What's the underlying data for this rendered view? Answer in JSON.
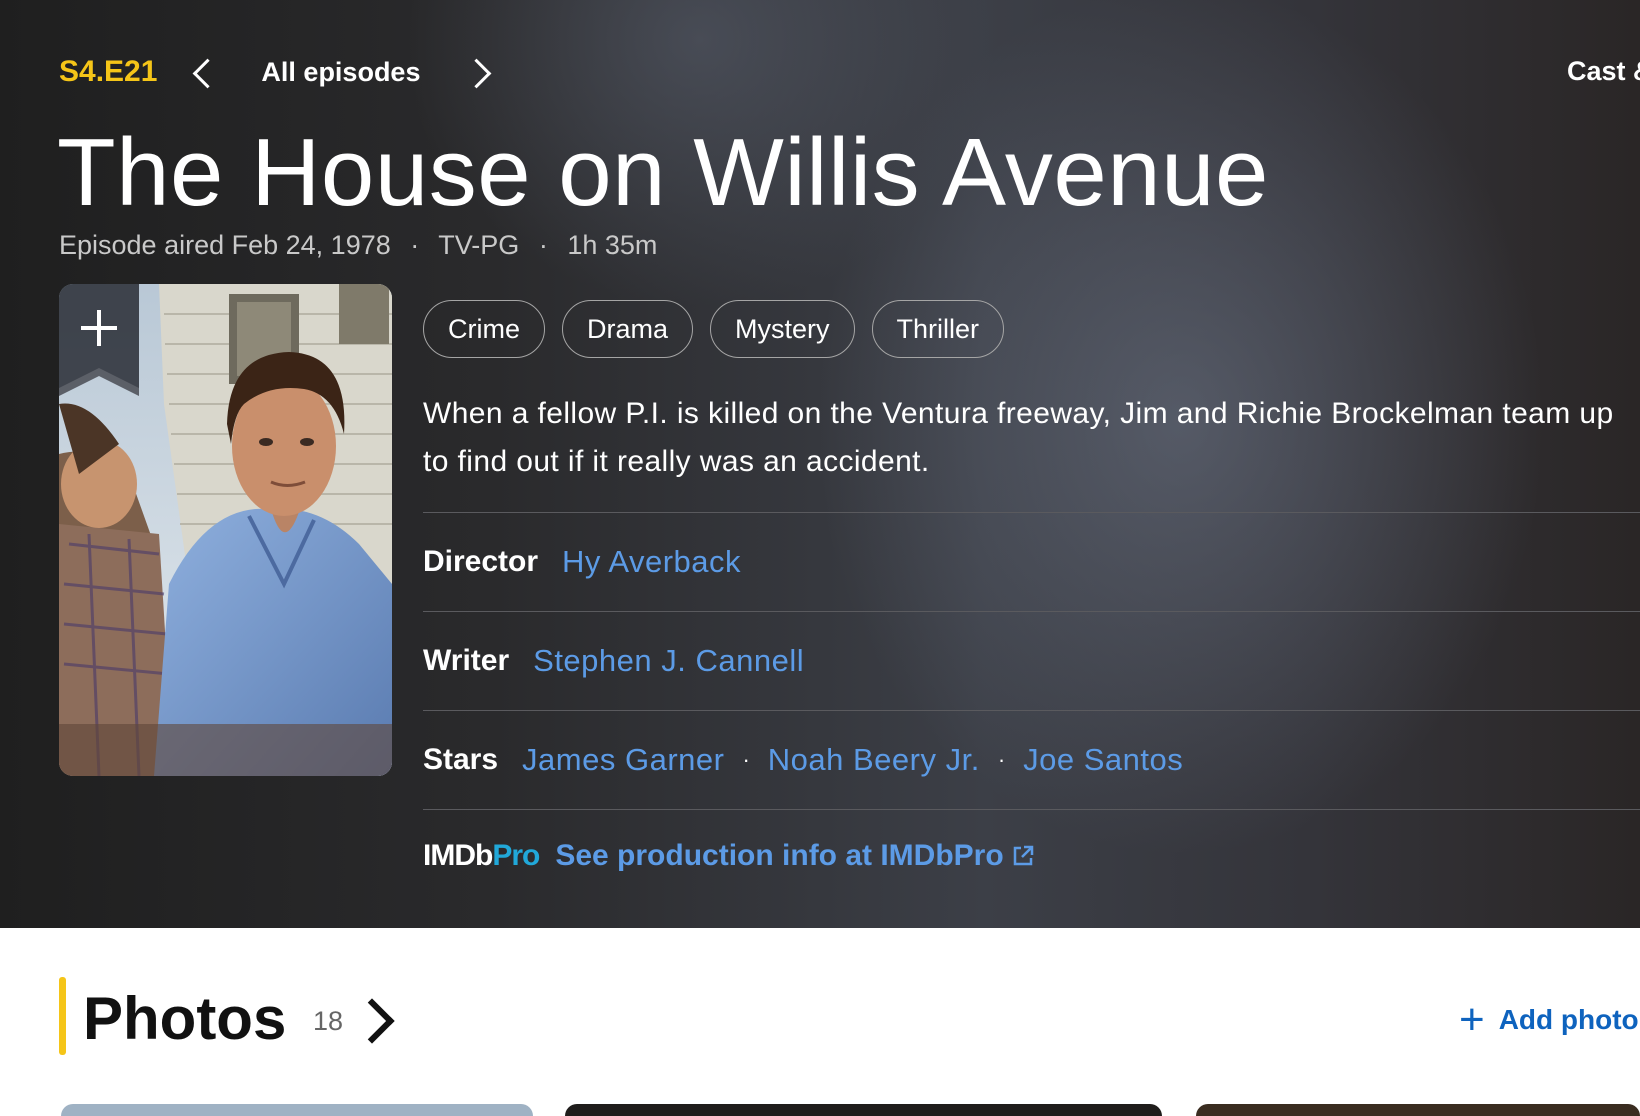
{
  "episode_nav": {
    "code": "S4.E21",
    "all_episodes": "All episodes",
    "cast_link": "Cast &"
  },
  "title": "The House on Willis Avenue",
  "meta": {
    "aired": "Episode aired Feb 24, 1978",
    "rating": "TV-PG",
    "runtime": "1h 35m",
    "separator": "·"
  },
  "watchlist": {
    "icon": "plus-icon"
  },
  "genres": [
    "Crime",
    "Drama",
    "Mystery",
    "Thriller"
  ],
  "plot": "When a fellow P.I. is killed on the Ventura freeway, Jim and Richie Brockelman team up to find out if it really was an accident.",
  "credits": {
    "director_label": "Director",
    "director": "Hy Averback",
    "writer_label": "Writer",
    "writer": "Stephen J. Cannell",
    "stars_label": "Stars",
    "stars": [
      "James Garner",
      "Noah Beery Jr.",
      "Joe Santos"
    ]
  },
  "imdbpro": {
    "logo_imdb": "IMDb",
    "logo_pro": "Pro",
    "link": "See production info at IMDbPro",
    "icon": "external-link-icon"
  },
  "photos": {
    "title": "Photos",
    "count": "18",
    "add_label": "Add photo"
  },
  "colors": {
    "accent": "#f5c518",
    "link": "#5c9be6",
    "pro": "#21a8d9",
    "add_link": "#0e63be"
  }
}
